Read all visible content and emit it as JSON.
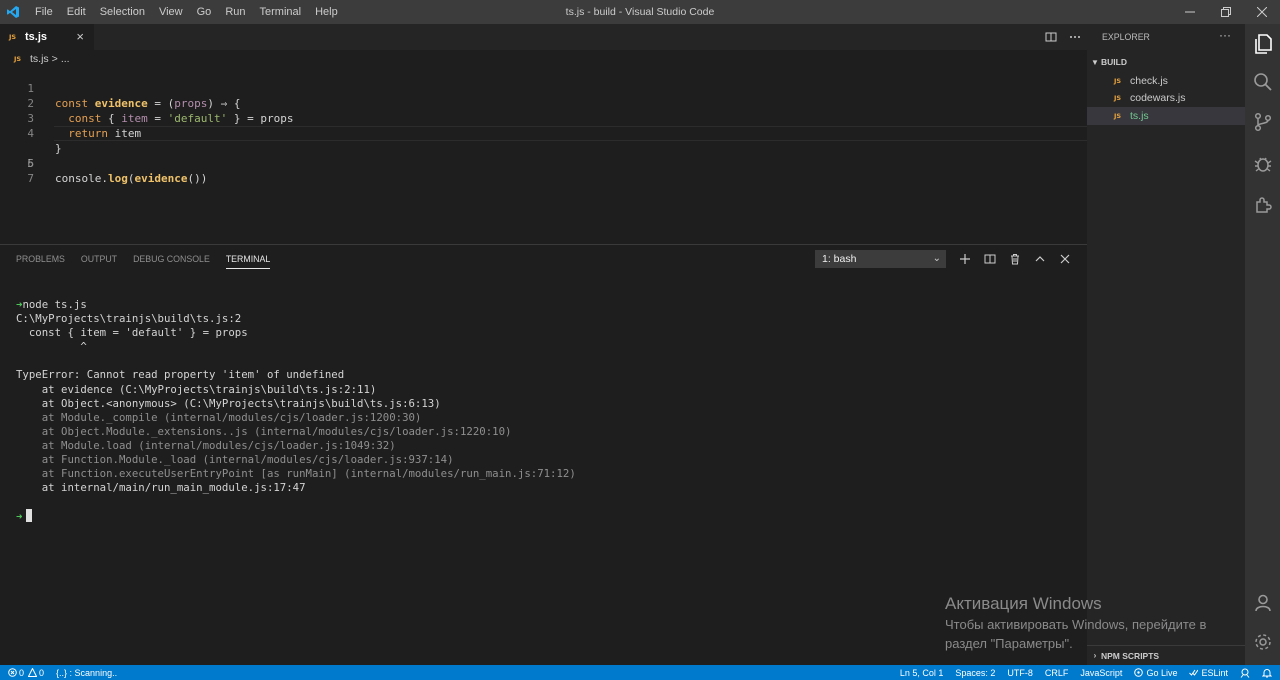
{
  "window": {
    "title": "ts.js - build - Visual Studio Code",
    "menu": [
      "File",
      "Edit",
      "Selection",
      "View",
      "Go",
      "Run",
      "Terminal",
      "Help"
    ]
  },
  "editor": {
    "tab": {
      "badge": "JS",
      "label": "ts.js",
      "close": "×"
    },
    "breadcrumb": {
      "badge": "JS",
      "file": "ts.js",
      "sep": ">",
      "rest": "..."
    },
    "line_numbers": [
      "1",
      "2",
      "3",
      "4",
      "5",
      "6",
      "7"
    ],
    "lines": {
      "l1": {
        "kw": "const",
        "fn": "evidence",
        "mid": " = (",
        "prm": "props",
        "end": ") ⇒ {"
      },
      "l2": {
        "kw": "const",
        "open": " { ",
        "prm": "item",
        "eq": " = ",
        "str": "'default'",
        "end": " } = props"
      },
      "l3": {
        "kw": "return",
        "end": " item"
      },
      "l4": {
        "end": "}"
      },
      "l6": {
        "pre": "console.",
        "fn": "log",
        "mid": "(",
        "fn2": "evidence",
        "end": "())"
      }
    }
  },
  "panel": {
    "tabs": [
      "PROBLEMS",
      "OUTPUT",
      "DEBUG CONSOLE",
      "TERMINAL"
    ],
    "active_tab": "TERMINAL",
    "terminal_select": "1: bash",
    "terminal": {
      "prompt": "➜",
      "command": "node ts.js",
      "lines": [
        "C:\\MyProjects\\trainjs\\build\\ts.js:2",
        "  const { item = 'default' } = props",
        "          ^",
        "",
        "TypeError: Cannot read property 'item' of undefined",
        "    at evidence (C:\\MyProjects\\trainjs\\build\\ts.js:2:11)",
        "    at Object.<anonymous> (C:\\MyProjects\\trainjs\\build\\ts.js:6:13)"
      ],
      "dim_lines": [
        "    at Module._compile (internal/modules/cjs/loader.js:1200:30)",
        "    at Object.Module._extensions..js (internal/modules/cjs/loader.js:1220:10)",
        "    at Module.load (internal/modules/cjs/loader.js:1049:32)",
        "    at Function.Module._load (internal/modules/cjs/loader.js:937:14)",
        "    at Function.executeUserEntryPoint [as runMain] (internal/modules/run_main.js:71:12)"
      ],
      "last_line": "    at internal/main/run_main_module.js:17:47"
    }
  },
  "explorer": {
    "header": "EXPLORER",
    "folder": "BUILD",
    "files": [
      {
        "badge": "JS",
        "name": "check.js"
      },
      {
        "badge": "JS",
        "name": "codewars.js"
      },
      {
        "badge": "JS",
        "name": "ts.js"
      }
    ],
    "npm": "NPM SCRIPTS"
  },
  "watermark": {
    "title": "Активация Windows",
    "text": "Чтобы активировать Windows, перейдите в раздел \"Параметры\"."
  },
  "status": {
    "errors": "0",
    "warnings": "0",
    "scanning": "{..} : Scanning..",
    "position": "Ln 5, Col 1",
    "spaces": "Spaces: 2",
    "encoding": "UTF-8",
    "eol": "CRLF",
    "language": "JavaScript",
    "golive": "Go Live",
    "eslint": "ESLint"
  },
  "colors": {
    "accent": "#007acc",
    "js_badge": "#e8a33c",
    "git_added": "#73c991",
    "prompt": "#4ec45a"
  }
}
